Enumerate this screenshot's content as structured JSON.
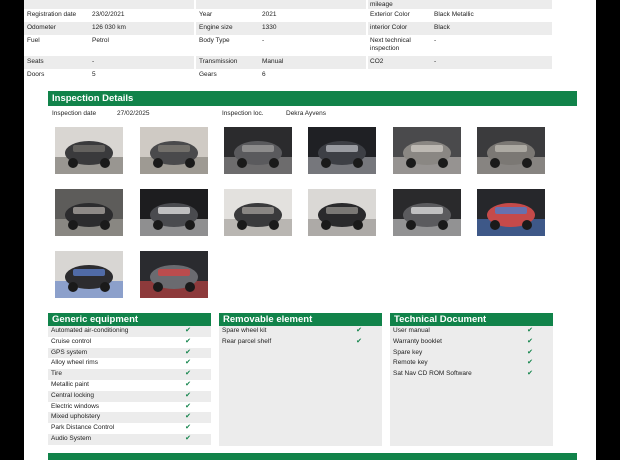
{
  "top_block": {
    "rows": [
      {
        "label1": "Registration date",
        "value1": "23/02/2021",
        "label2": "Year",
        "value2": "2021",
        "label3": "Exterior Color",
        "value3": "Black Metallic"
      },
      {
        "label1": "Odometer",
        "value1": "126 030 km",
        "label2": "Engine size",
        "value2": "1330",
        "label3": "interior Color",
        "value3": "Black"
      },
      {
        "label1": "Fuel",
        "value1": "Petrol",
        "label2": "Body Type",
        "value2": "-",
        "label3": "Next technical inspection",
        "value3": "-"
      },
      {
        "label1": "Seats",
        "value1": "-",
        "label2": "Transmission",
        "value2": "Manual",
        "label3": "CO2",
        "value3": "-"
      },
      {
        "label1": "Doors",
        "value1": "5",
        "label2": "Gears",
        "value2": "6",
        "label3": "",
        "value3": ""
      }
    ],
    "top_partial": "mileage"
  },
  "inspection": {
    "title": "Inspection Details",
    "date_label": "Inspection date",
    "date_value": "27/02/2025",
    "loc_label": "Inspection loc.",
    "loc_value": "Dekra Ayvens"
  },
  "photos": [
    {
      "name": "car-front-photo"
    },
    {
      "name": "car-rear-photo"
    },
    {
      "name": "dashboard-photo"
    },
    {
      "name": "instrument-cluster-photo"
    },
    {
      "name": "front-seats-photo"
    },
    {
      "name": "rear-seats-photo"
    },
    {
      "name": "trunk-photo"
    },
    {
      "name": "engine-bay-photo"
    },
    {
      "name": "underside-photo"
    },
    {
      "name": "wheel-photo"
    },
    {
      "name": "door-panel-photo"
    },
    {
      "name": "infotainment-photo"
    },
    {
      "name": "climate-screen-photo"
    },
    {
      "name": "climate-controls-photo"
    }
  ],
  "generic_equipment": {
    "title": "Generic equipment",
    "items": [
      "Automated air-conditioning",
      "Cruise control",
      "GPS system",
      "Alloy wheel rims",
      "Tire",
      "Metallic paint",
      "Central locking",
      "Electric windows",
      "Mixed upholstery",
      "Park Distance Control",
      "Audio System"
    ]
  },
  "removable_element": {
    "title": "Removable element",
    "items": [
      "Spare wheel kit",
      "Rear parcel shelf"
    ]
  },
  "technical_document": {
    "title": "Technical Document",
    "items": [
      "User manual",
      "Warranty booklet",
      "Spare key",
      "Remote key",
      "Sat Nav CD ROM Software"
    ]
  },
  "colors": {
    "accent": "#11834a"
  }
}
